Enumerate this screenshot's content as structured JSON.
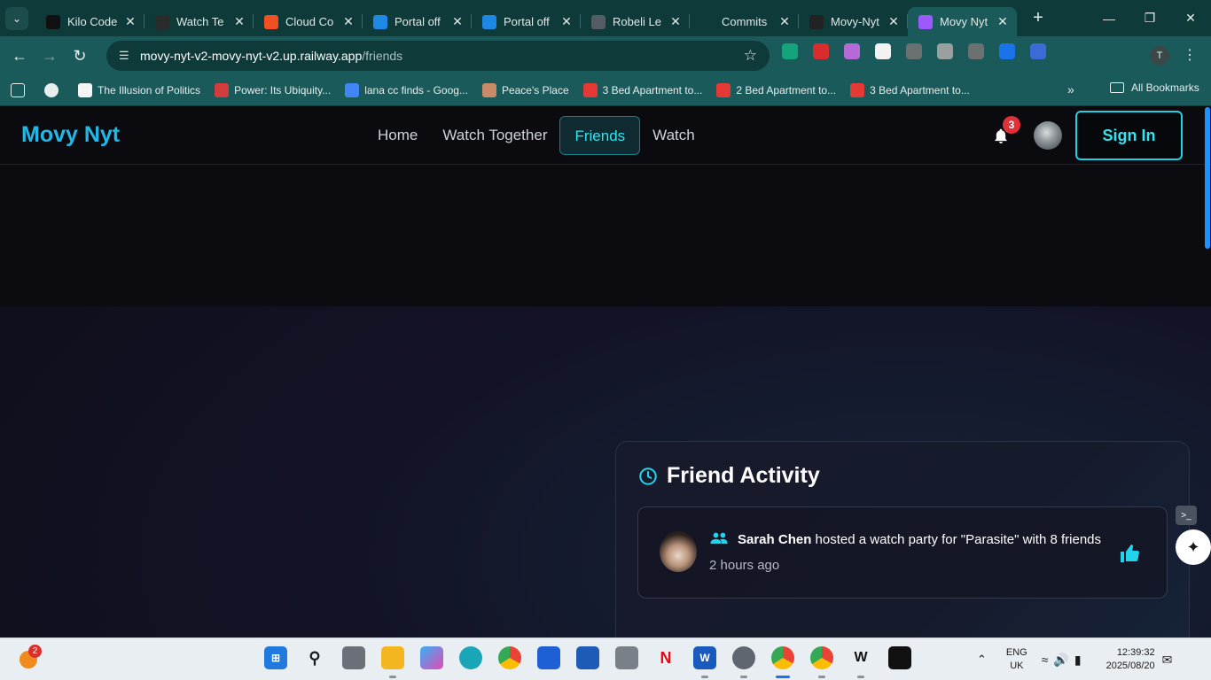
{
  "browser": {
    "tabs": [
      {
        "title": "Kilo Code",
        "icon": "kilo-icon",
        "color": "#111111",
        "active": false
      },
      {
        "title": "Watch Te",
        "icon": "watch-icon",
        "color": "#2b2b2b",
        "active": false
      },
      {
        "title": "Cloud Co",
        "icon": "microsoft-icon",
        "color": "#f25022",
        "active": false
      },
      {
        "title": "Portal off",
        "icon": "azure-icon",
        "color": "#1e88e5",
        "active": false
      },
      {
        "title": "Portal off",
        "icon": "azure-icon",
        "color": "#1e88e5",
        "active": false
      },
      {
        "title": "Robeli Le",
        "icon": "globe-icon",
        "color": "#555c63",
        "active": false
      },
      {
        "title": "Commits",
        "icon": "github-icon",
        "color": "#0e3a3a",
        "active": false
      },
      {
        "title": "Movy-Nyt",
        "icon": "vercel-icon",
        "color": "#222222",
        "active": false
      },
      {
        "title": "Movy Nyt",
        "icon": "vite-icon",
        "color": "#9b59ff",
        "active": true
      }
    ],
    "url_host": "movy-nyt-v2-movy-nyt-v2.up.railway.app",
    "url_path": "/friends",
    "extensions": [
      {
        "icon": "grammarly-icon",
        "color": "#15a37c"
      },
      {
        "icon": "adblock-icon",
        "color": "#d92c2c"
      },
      {
        "icon": "mail-icon",
        "color": "#b66ad8"
      },
      {
        "icon": "puzzle-game-icon",
        "color": "#f2f2f2"
      },
      {
        "icon": "paint-icon",
        "color": "#6b7070"
      },
      {
        "icon": "ext-r-icon",
        "color": "#9aa0a0"
      },
      {
        "icon": "scales-icon",
        "color": "#6b7070"
      },
      {
        "icon": "c-icon",
        "color": "#1a73e8"
      },
      {
        "icon": "rocket-icon",
        "color": "#3b6bd6"
      },
      {
        "icon": "extensions-icon",
        "color": "#1b5a5a"
      },
      {
        "icon": "media-icon",
        "color": "#1b5a5a"
      }
    ],
    "profile_initial": "T",
    "bookmarks": [
      {
        "label": "The Illusion of Politics",
        "color": "#f5f5f5"
      },
      {
        "label": "Power: Its Ubiquity...",
        "color": "#d33c3c"
      },
      {
        "label": "lana cc finds - Goog...",
        "color": "#4285f4"
      },
      {
        "label": "Peace's Place",
        "color": "#c98a6a"
      },
      {
        "label": "3 Bed Apartment to...",
        "color": "#e53935"
      },
      {
        "label": "2 Bed Apartment to...",
        "color": "#e53935"
      },
      {
        "label": "3 Bed Apartment to...",
        "color": "#e53935"
      }
    ],
    "all_bookmarks": "All Bookmarks"
  },
  "site": {
    "brand": "Movy Nyt",
    "nav": [
      {
        "label": "Home",
        "active": false
      },
      {
        "label": "Watch Together",
        "active": false
      },
      {
        "label": "Friends",
        "active": true
      },
      {
        "label": "Watch",
        "active": false
      }
    ],
    "notification_count": "3",
    "sign_in": "Sign In",
    "accent": "#22d3ee"
  },
  "activity": {
    "title": "Friend Activity",
    "items": [
      {
        "name": "Sarah Chen",
        "text": " hosted a watch party for \"Parasite\" with 8 friends",
        "time": "2 hours ago"
      }
    ]
  },
  "taskbar": {
    "weather_badge": "2",
    "lang_line1": "ENG",
    "lang_line2": "UK",
    "time": "12:39:32",
    "date": "2025/08/20"
  }
}
